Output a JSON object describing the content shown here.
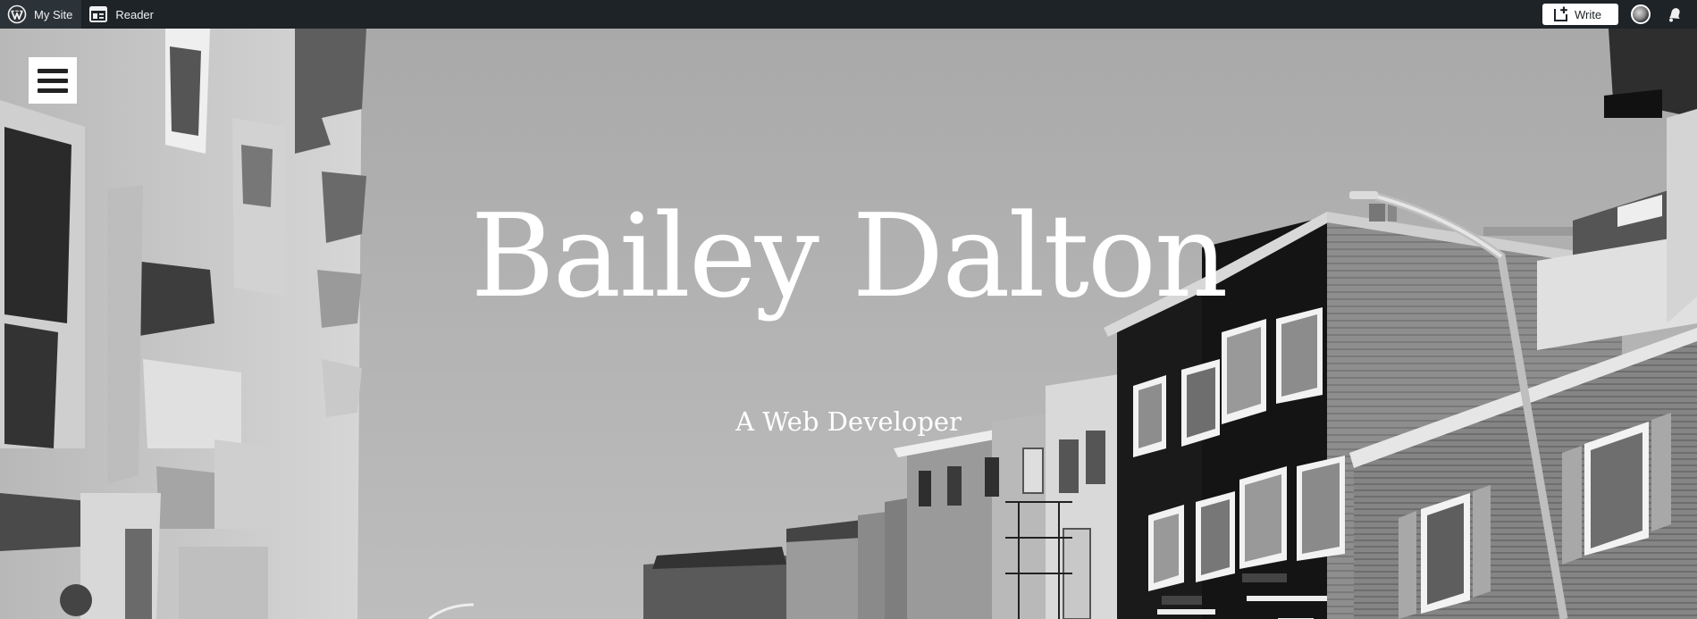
{
  "adminbar": {
    "my_site_label": "My Site",
    "reader_label": "Reader",
    "write_label": "Write",
    "icons": {
      "wordpress": "wordpress-logo-icon",
      "reader": "reader-icon",
      "write": "write-plus-icon",
      "avatar": "avatar",
      "notifications": "bell-icon"
    }
  },
  "header": {
    "site_title": "Bailey Dalton",
    "site_description": "A Web Developer",
    "menu_icon": "hamburger-menu-icon"
  },
  "colors": {
    "adminbar_bg": "#1d2327",
    "adminbar_text": "#f0f0f1",
    "title_text": "#ffffff"
  }
}
